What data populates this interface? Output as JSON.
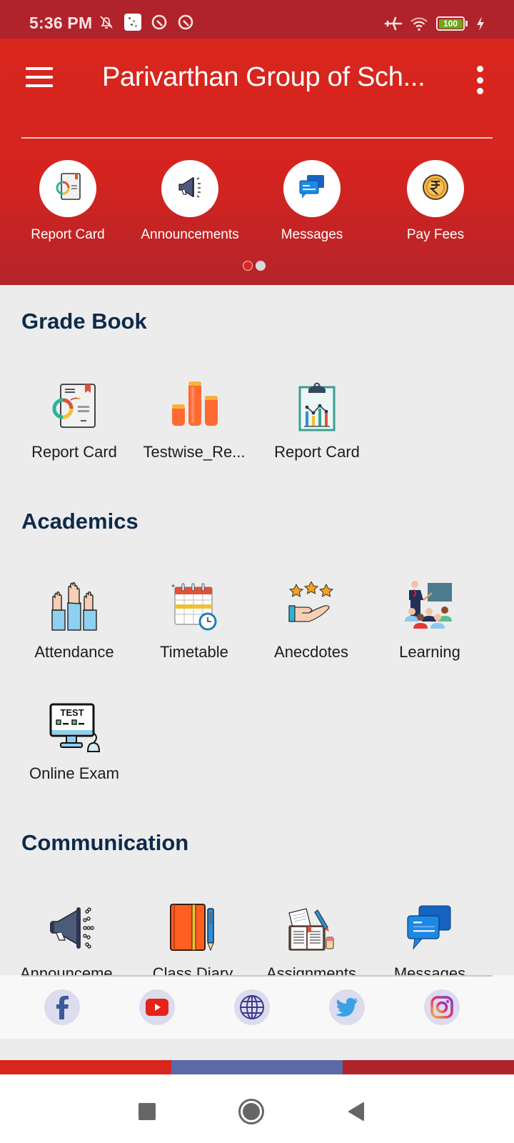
{
  "status_bar": {
    "time": "5:36 PM",
    "left_icons": [
      "notifications-muted-icon",
      "app-notification-icon",
      "data-saver-icon",
      "data-saver-icon"
    ],
    "right_icons": [
      "airplane-mode-icon",
      "wifi-icon",
      "battery-icon",
      "charging-icon"
    ],
    "battery_level": "100"
  },
  "header": {
    "title": "Parivarthan Group of Sch...",
    "menu_icon": "hamburger-menu-icon",
    "overflow_icon": "more-vert-icon",
    "quick_actions": [
      {
        "label": "Report Card",
        "icon": "report-card-icon"
      },
      {
        "label": "Announcements",
        "icon": "megaphone-icon"
      },
      {
        "label": "Messages",
        "icon": "chat-bubbles-icon"
      },
      {
        "label": "Pay Fees",
        "icon": "rupee-coin-icon"
      }
    ],
    "pager": {
      "pages": 2,
      "active_page": 1
    }
  },
  "sections": [
    {
      "title": "Grade Book",
      "items": [
        {
          "label": "Report Card",
          "icon": "report-card-icon"
        },
        {
          "label": "Testwise_Re...",
          "icon": "bar-columns-icon"
        },
        {
          "label": "Report Card",
          "icon": "clipboard-chart-icon"
        }
      ]
    },
    {
      "title": "Academics",
      "items": [
        {
          "label": "Attendance",
          "icon": "raised-hands-icon"
        },
        {
          "label": "Timetable",
          "icon": "calendar-clock-icon"
        },
        {
          "label": "Anecdotes",
          "icon": "stars-hand-icon"
        },
        {
          "label": "Learning",
          "icon": "teacher-class-icon"
        },
        {
          "label": "Online Exam",
          "icon": "test-monitor-icon"
        }
      ]
    },
    {
      "title": "Communication",
      "items": [
        {
          "label": "Announceme...",
          "icon": "megaphone-icon"
        },
        {
          "label": "Class Diary",
          "icon": "notebook-pen-icon"
        },
        {
          "label": "Assignments",
          "icon": "book-pencil-icon"
        },
        {
          "label": "Messages",
          "icon": "chat-bubbles-icon"
        }
      ]
    }
  ],
  "social_links": [
    {
      "name": "facebook",
      "icon": "facebook-icon"
    },
    {
      "name": "youtube",
      "icon": "youtube-icon"
    },
    {
      "name": "website",
      "icon": "globe-icon"
    },
    {
      "name": "twitter",
      "icon": "twitter-icon"
    },
    {
      "name": "instagram",
      "icon": "instagram-icon"
    }
  ],
  "colors": {
    "status_bar": "#b0232a",
    "header_red": "#d8261d",
    "section_title": "#0d2a4a",
    "tricolor": [
      "#d8261d",
      "#5a6aa8",
      "#b0232a"
    ]
  },
  "system_nav": {
    "recents_icon": "recents-square-icon",
    "home_icon": "home-circle-icon",
    "back_icon": "back-triangle-icon"
  }
}
